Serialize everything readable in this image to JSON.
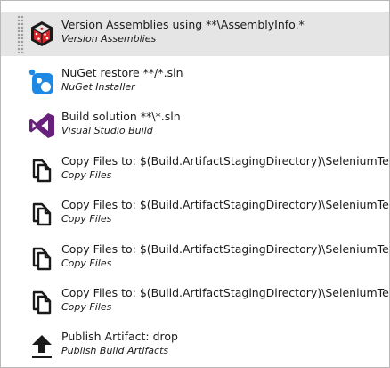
{
  "tasks": [
    {
      "title": "Version Assemblies using **\\AssemblyInfo.*",
      "subtitle": "Version Assemblies",
      "icon": "version-assemblies-icon",
      "selected": true
    },
    {
      "title": "NuGet restore **/*.sln",
      "subtitle": "NuGet Installer",
      "icon": "nuget-icon",
      "selected": false
    },
    {
      "title": "Build solution **\\*.sln",
      "subtitle": "Visual Studio Build",
      "icon": "visual-studio-icon",
      "selected": false
    },
    {
      "title": "Copy Files to: $(Build.ArtifactStagingDirectory)\\SeleniumTests",
      "subtitle": "Copy Files",
      "icon": "copy-files-icon",
      "selected": false
    },
    {
      "title": "Copy Files to: $(Build.ArtifactStagingDirectory)\\SeleniumTests",
      "subtitle": "Copy Files",
      "icon": "copy-files-icon",
      "selected": false
    },
    {
      "title": "Copy Files to: $(Build.ArtifactStagingDirectory)\\SeleniumTests",
      "subtitle": "Copy Files",
      "icon": "copy-files-icon",
      "selected": false
    },
    {
      "title": "Copy Files to: $(Build.ArtifactStagingDirectory)\\SeleniumTests",
      "subtitle": "Copy Files",
      "icon": "copy-files-icon",
      "selected": false
    },
    {
      "title": "Publish Artifact: drop",
      "subtitle": "Publish Build Artifacts",
      "icon": "upload-arrow-icon",
      "selected": false
    }
  ],
  "colors": {
    "selected_row": "#e5e5e5",
    "nuget_blue": "#1e88e5",
    "visual_studio_purple": "#68217a",
    "version_red": "#d9262b"
  }
}
